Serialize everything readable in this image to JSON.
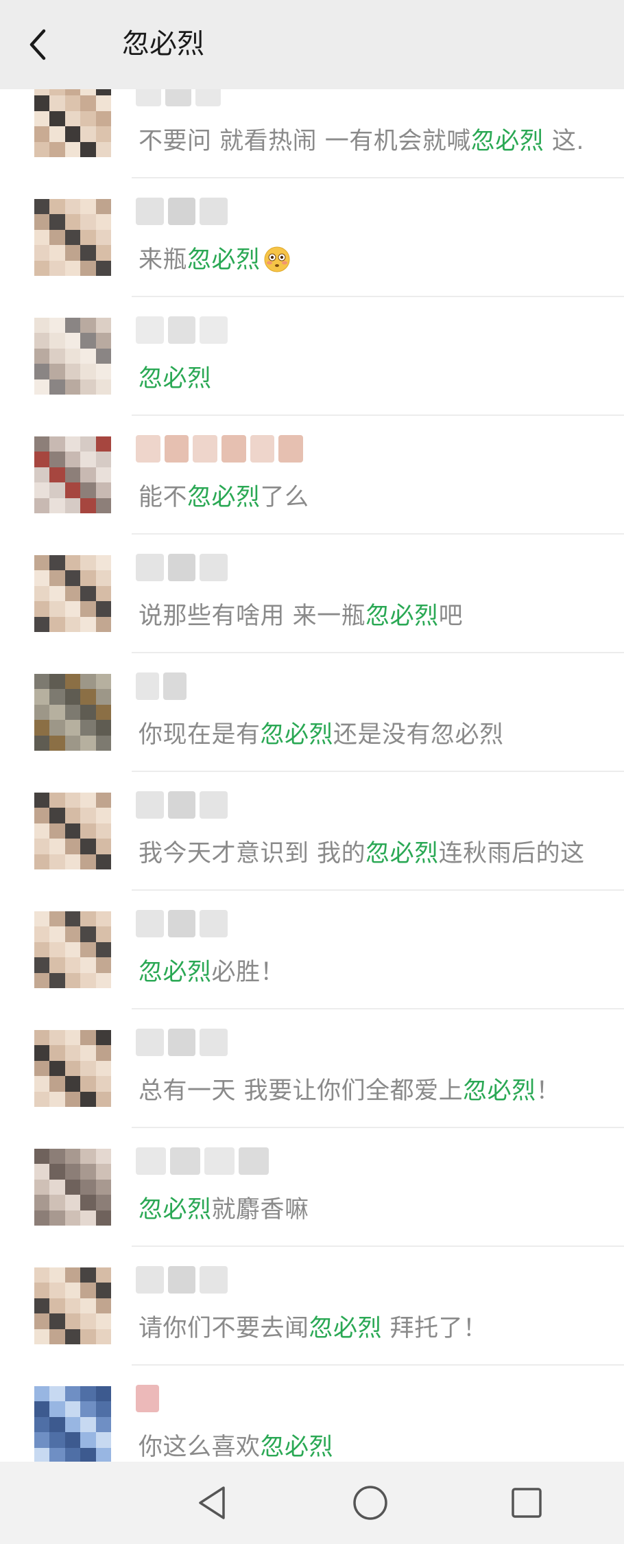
{
  "header": {
    "title": "忽必烈"
  },
  "comments": [
    {
      "parts": [
        {
          "t": "不要问  就看热闹  一有机会就喊"
        },
        {
          "t": "忽必烈",
          "h": true
        },
        {
          "t": "  这."
        }
      ]
    },
    {
      "parts": [
        {
          "t": "来瓶"
        },
        {
          "t": "忽必烈",
          "h": true
        }
      ],
      "emoji": "flushed-face-emoji"
    },
    {
      "parts": [
        {
          "t": "忽必烈",
          "h": true
        }
      ]
    },
    {
      "parts": [
        {
          "t": "能不"
        },
        {
          "t": "忽必烈",
          "h": true
        },
        {
          "t": "了么"
        }
      ]
    },
    {
      "parts": [
        {
          "t": "说那些有啥用   来一瓶"
        },
        {
          "t": "忽必烈",
          "h": true
        },
        {
          "t": "吧"
        }
      ]
    },
    {
      "parts": [
        {
          "t": "你现在是有"
        },
        {
          "t": "忽必烈",
          "h": true
        },
        {
          "t": "还是没有忽必烈"
        }
      ]
    },
    {
      "parts": [
        {
          "t": "我今天才意识到   我的"
        },
        {
          "t": "忽必烈",
          "h": true
        },
        {
          "t": "连秋雨后的这"
        }
      ]
    },
    {
      "parts": [
        {
          "t": "忽必烈",
          "h": true
        },
        {
          "t": "必胜！"
        }
      ]
    },
    {
      "parts": [
        {
          "t": "总有一天    我要让你们全都爱上"
        },
        {
          "t": "忽必烈",
          "h": true
        },
        {
          "t": "！"
        }
      ]
    },
    {
      "parts": [
        {
          "t": "忽必烈",
          "h": true
        },
        {
          "t": "就麝香嘛"
        }
      ]
    },
    {
      "parts": [
        {
          "t": "请你们不要去闻"
        },
        {
          "t": "忽必烈",
          "h": true
        },
        {
          "t": "    拜托了！"
        }
      ]
    },
    {
      "parts": [
        {
          "t": "你这么喜欢"
        },
        {
          "t": "忽必烈",
          "h": true
        }
      ]
    }
  ],
  "icons": {
    "back": "back-arrow-icon",
    "nav_back": "nav-back-triangle-icon",
    "nav_home": "nav-home-circle-icon",
    "nav_recent": "nav-recents-square-icon"
  },
  "colors": {
    "highlight": "#2aa854",
    "text": "#8a8a8a",
    "topbar": "#ededed"
  }
}
